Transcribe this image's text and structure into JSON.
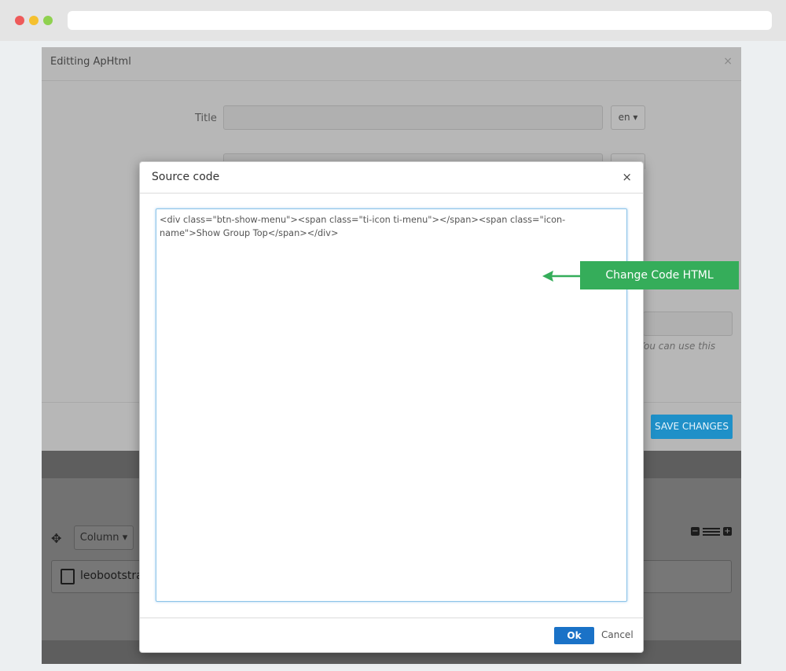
{
  "browser": {
    "url": ""
  },
  "back_modal": {
    "title": "Editting ApHtml",
    "close": "×",
    "title_label": "Title",
    "lang": "en",
    "help_text": "You can use this",
    "save_label": "SAVE CHANGES"
  },
  "back_layout": {
    "column_label": "Column",
    "widget_label": "leobootstra"
  },
  "dialog": {
    "title": "Source code",
    "close": "×",
    "code": "<div class=\"btn-show-menu\"><span class=\"ti-icon ti-menu\"></span><span class=\"icon-name\">Show Group Top</span></div>",
    "ok_label": "Ok",
    "cancel_label": "Cancel"
  },
  "annotation": {
    "label": "Change Code HTML",
    "color": "#35ad5a"
  }
}
